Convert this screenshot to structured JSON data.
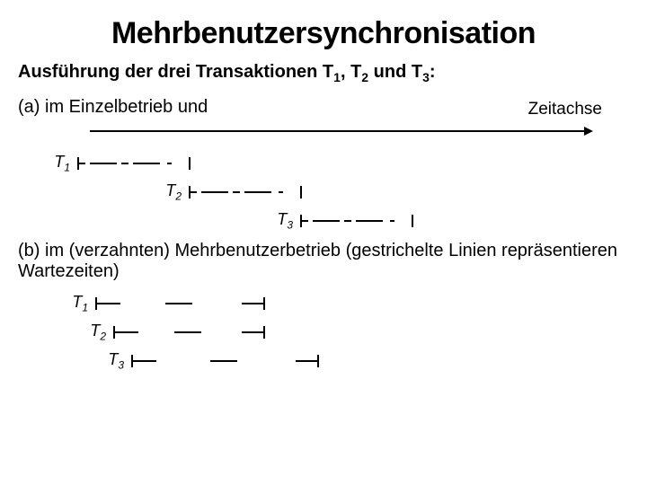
{
  "title": "Mehrbenutzersynchronisation",
  "subtitle_pre": "Ausführung der drei Transaktionen T",
  "subtitle_s1": "1",
  "subtitle_mid1": ", T",
  "subtitle_s2": "2",
  "subtitle_mid2": " und T",
  "subtitle_s3": "3",
  "subtitle_post": ":",
  "part_a": "(a) im Einzelbetrieb und",
  "axis_label": "Zeitachse",
  "t_label": "T",
  "sub1": "1",
  "sub2": "2",
  "sub3": "3",
  "part_b": "(b) im (verzahnten) Mehrbenutzerbetrieb (gestrichelte Linien repräsentieren Wartezeiten)",
  "chart_data": {
    "type": "timeline",
    "description": "Execution of three transactions T1, T2, T3",
    "part_a": {
      "mode": "single-user (sequential)",
      "axis": "Zeitachse",
      "bars": [
        {
          "name": "T1",
          "start": 0,
          "end": 120,
          "style": "dashed"
        },
        {
          "name": "T2",
          "start": 120,
          "end": 240,
          "style": "dashed"
        },
        {
          "name": "T3",
          "start": 240,
          "end": 360,
          "style": "dashed"
        }
      ]
    },
    "part_b": {
      "mode": "multi-user (interleaved)",
      "note": "dashed = wait time",
      "bars": [
        {
          "name": "T1",
          "segments": [
            {
              "start": 0,
              "end": 30,
              "solid": true
            },
            {
              "start": 30,
              "end": 80,
              "solid": false
            },
            {
              "start": 80,
              "end": 110,
              "solid": true
            },
            {
              "start": 110,
              "end": 160,
              "solid": false
            },
            {
              "start": 160,
              "end": 190,
              "solid": true
            }
          ]
        },
        {
          "name": "T2",
          "segments": [
            {
              "start": 0,
              "end": 30,
              "solid": true
            },
            {
              "start": 30,
              "end": 70,
              "solid": false
            },
            {
              "start": 70,
              "end": 100,
              "solid": true
            },
            {
              "start": 100,
              "end": 140,
              "solid": false
            },
            {
              "start": 140,
              "end": 170,
              "solid": true
            }
          ]
        },
        {
          "name": "T3",
          "segments": [
            {
              "start": 0,
              "end": 30,
              "solid": true
            },
            {
              "start": 30,
              "end": 90,
              "solid": false
            },
            {
              "start": 90,
              "end": 120,
              "solid": true
            },
            {
              "start": 120,
              "end": 180,
              "solid": false
            },
            {
              "start": 180,
              "end": 210,
              "solid": true
            }
          ]
        }
      ]
    }
  }
}
